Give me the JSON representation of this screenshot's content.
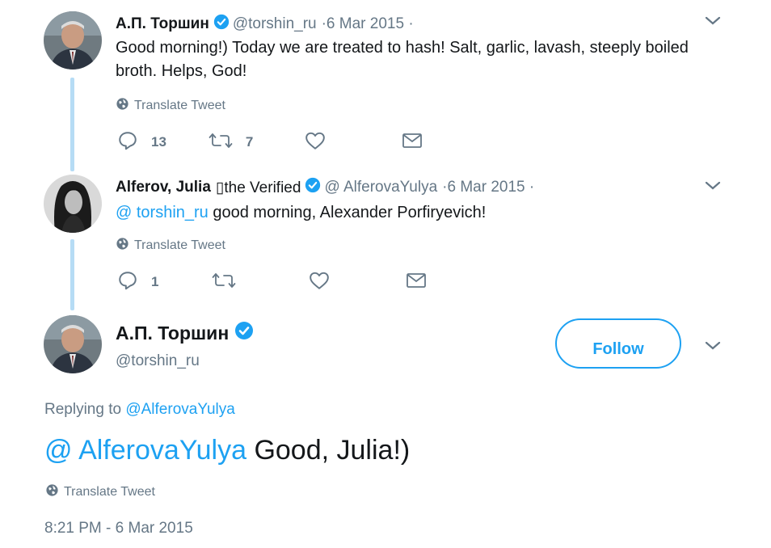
{
  "tweets": [
    {
      "author": "А.П. Торшин",
      "handle": "@torshin_ru",
      "date": "·6 Mar 2015 ·",
      "text": "Good morning!) Today we are treated to hash! Salt, garlic, lavash, steeply boiled broth. Helps, God!",
      "translate": "Translate Tweet",
      "replies": "13",
      "retweets": "7"
    },
    {
      "author": "Alferov, Julia",
      "author_suffix": "▯the Verified",
      "handle": "@ AlferovaYulya",
      "date": "·6 Mar 2015 ·",
      "mention": "@ torshin_ru",
      "text": " good morning, Alexander Porfiryevich!",
      "translate": "Translate Tweet",
      "replies": "1"
    }
  ],
  "main_tweet": {
    "author": "А.П. Торшин",
    "handle": "@torshin_ru",
    "follow_label": "Follow",
    "replying_prefix": "Replying to ",
    "replying_to": "@AlferovaYulya",
    "mention": "@ AlferovaYulya",
    "text": " Good, Julia!)",
    "translate": "Translate Tweet",
    "timestamp": "8:21 PM - 6 Mar 2015"
  },
  "colors": {
    "accent": "#1da1f2",
    "muted": "#657786",
    "thread_line": "#b6dcf5"
  },
  "icons": [
    "reply-icon",
    "retweet-icon",
    "like-icon",
    "dm-icon",
    "globe-icon",
    "verified-icon",
    "chevron-down-icon"
  ]
}
